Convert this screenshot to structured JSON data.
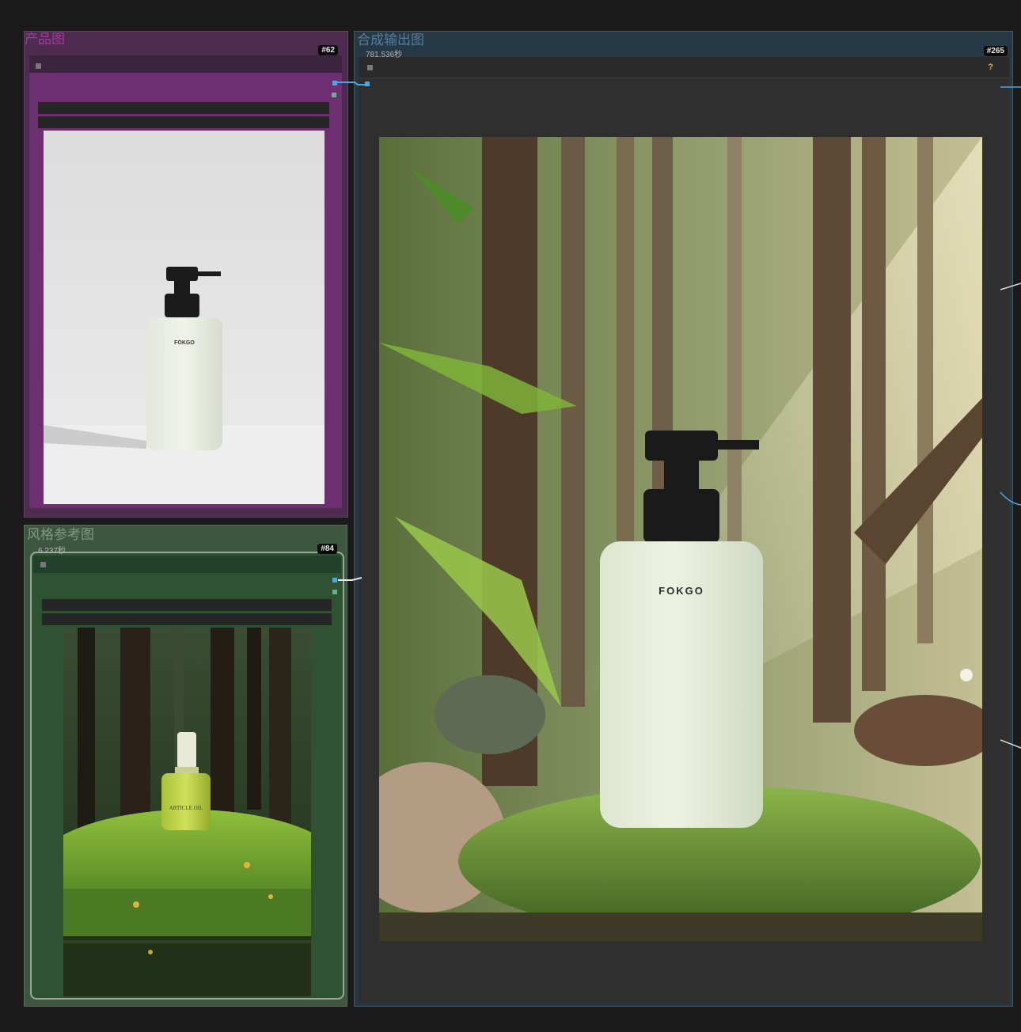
{
  "groups": {
    "product": {
      "title": "产品图",
      "color": "#a5399f"
    },
    "style": {
      "title": "风格参考图",
      "color": "#7e9a80"
    },
    "output": {
      "title": "合成输出图",
      "color": "#5a7d9a"
    }
  },
  "nodes": {
    "product": {
      "id": "#62",
      "image_brand": "FOKGO"
    },
    "style": {
      "id": "#84",
      "exec_time": "6.237秒",
      "image_label": "ARTICLE OIL"
    },
    "output": {
      "id": "#265",
      "exec_time": "781.536秒",
      "help": "?",
      "image_brand": "FOKGO"
    }
  },
  "colors": {
    "canvas": "#1b1b1b",
    "link_blue": "#4aa8e6",
    "slot_green": "#5fb28a",
    "help_orange": "#e6a23c"
  }
}
